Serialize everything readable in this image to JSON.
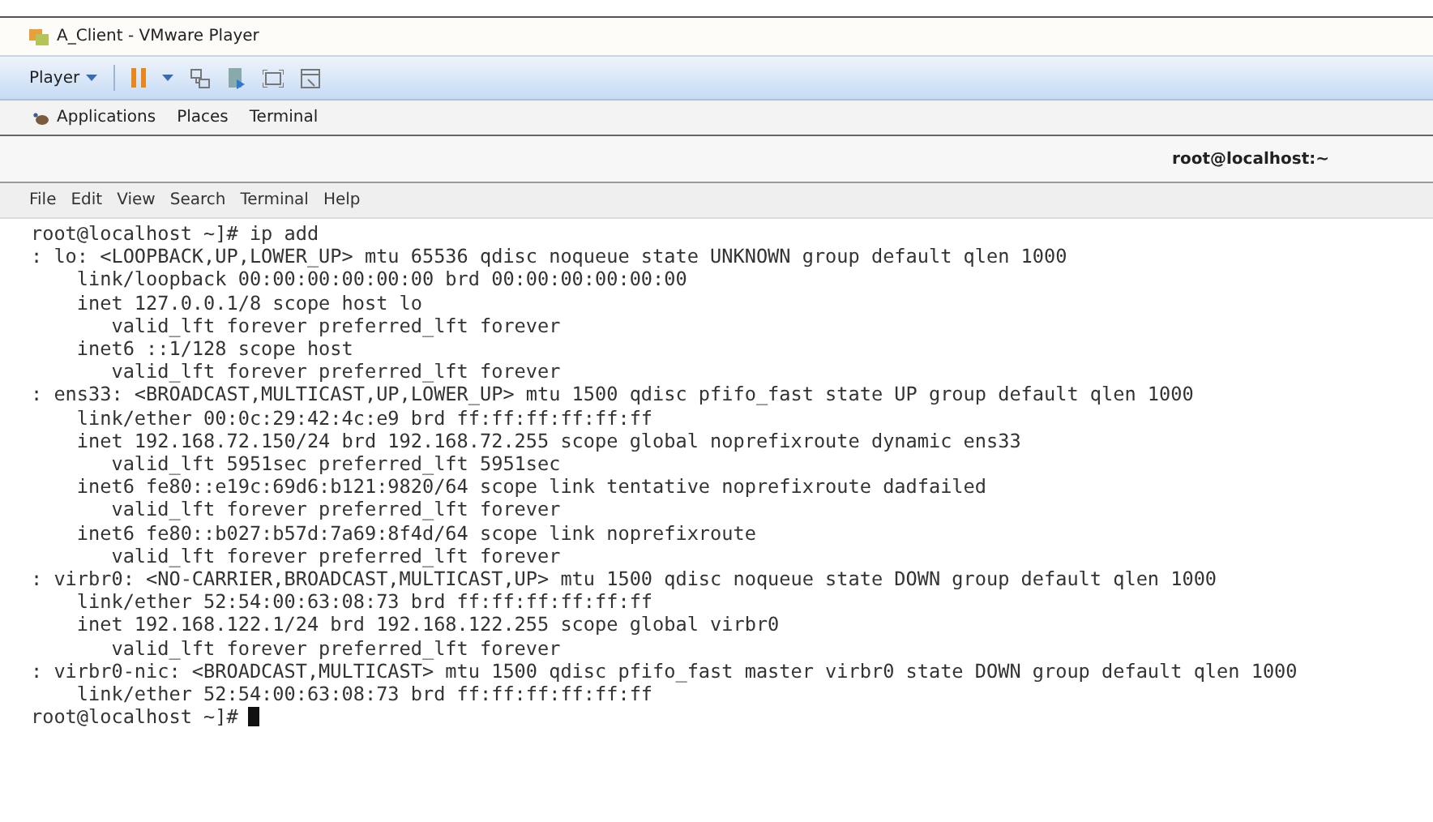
{
  "window": {
    "title": "A_Client - VMware Player"
  },
  "toolbar": {
    "player_menu": "Player"
  },
  "top_panel": {
    "items": [
      "Applications",
      "Places",
      "Terminal"
    ]
  },
  "terminal": {
    "title": "root@localhost:~",
    "menu": [
      "File",
      "Edit",
      "View",
      "Search",
      "Terminal",
      "Help"
    ],
    "lines": [
      "root@localhost ~]# ip add",
      ": lo: <LOOPBACK,UP,LOWER_UP> mtu 65536 qdisc noqueue state UNKNOWN group default qlen 1000",
      "    link/loopback 00:00:00:00:00:00 brd 00:00:00:00:00:00",
      "    inet 127.0.0.1/8 scope host lo",
      "       valid_lft forever preferred_lft forever",
      "    inet6 ::1/128 scope host",
      "       valid_lft forever preferred_lft forever",
      ": ens33: <BROADCAST,MULTICAST,UP,LOWER_UP> mtu 1500 qdisc pfifo_fast state UP group default qlen 1000",
      "    link/ether 00:0c:29:42:4c:e9 brd ff:ff:ff:ff:ff:ff",
      "    inet 192.168.72.150/24 brd 192.168.72.255 scope global noprefixroute dynamic ens33",
      "       valid_lft 5951sec preferred_lft 5951sec",
      "    inet6 fe80::e19c:69d6:b121:9820/64 scope link tentative noprefixroute dadfailed",
      "       valid_lft forever preferred_lft forever",
      "    inet6 fe80::b027:b57d:7a69:8f4d/64 scope link noprefixroute",
      "       valid_lft forever preferred_lft forever",
      ": virbr0: <NO-CARRIER,BROADCAST,MULTICAST,UP> mtu 1500 qdisc noqueue state DOWN group default qlen 1000",
      "    link/ether 52:54:00:63:08:73 brd ff:ff:ff:ff:ff:ff",
      "    inet 192.168.122.1/24 brd 192.168.122.255 scope global virbr0",
      "       valid_lft forever preferred_lft forever",
      ": virbr0-nic: <BROADCAST,MULTICAST> mtu 1500 qdisc pfifo_fast master virbr0 state DOWN group default qlen 1000",
      "    link/ether 52:54:00:63:08:73 brd ff:ff:ff:ff:ff:ff"
    ],
    "prompt": "root@localhost ~]#"
  }
}
